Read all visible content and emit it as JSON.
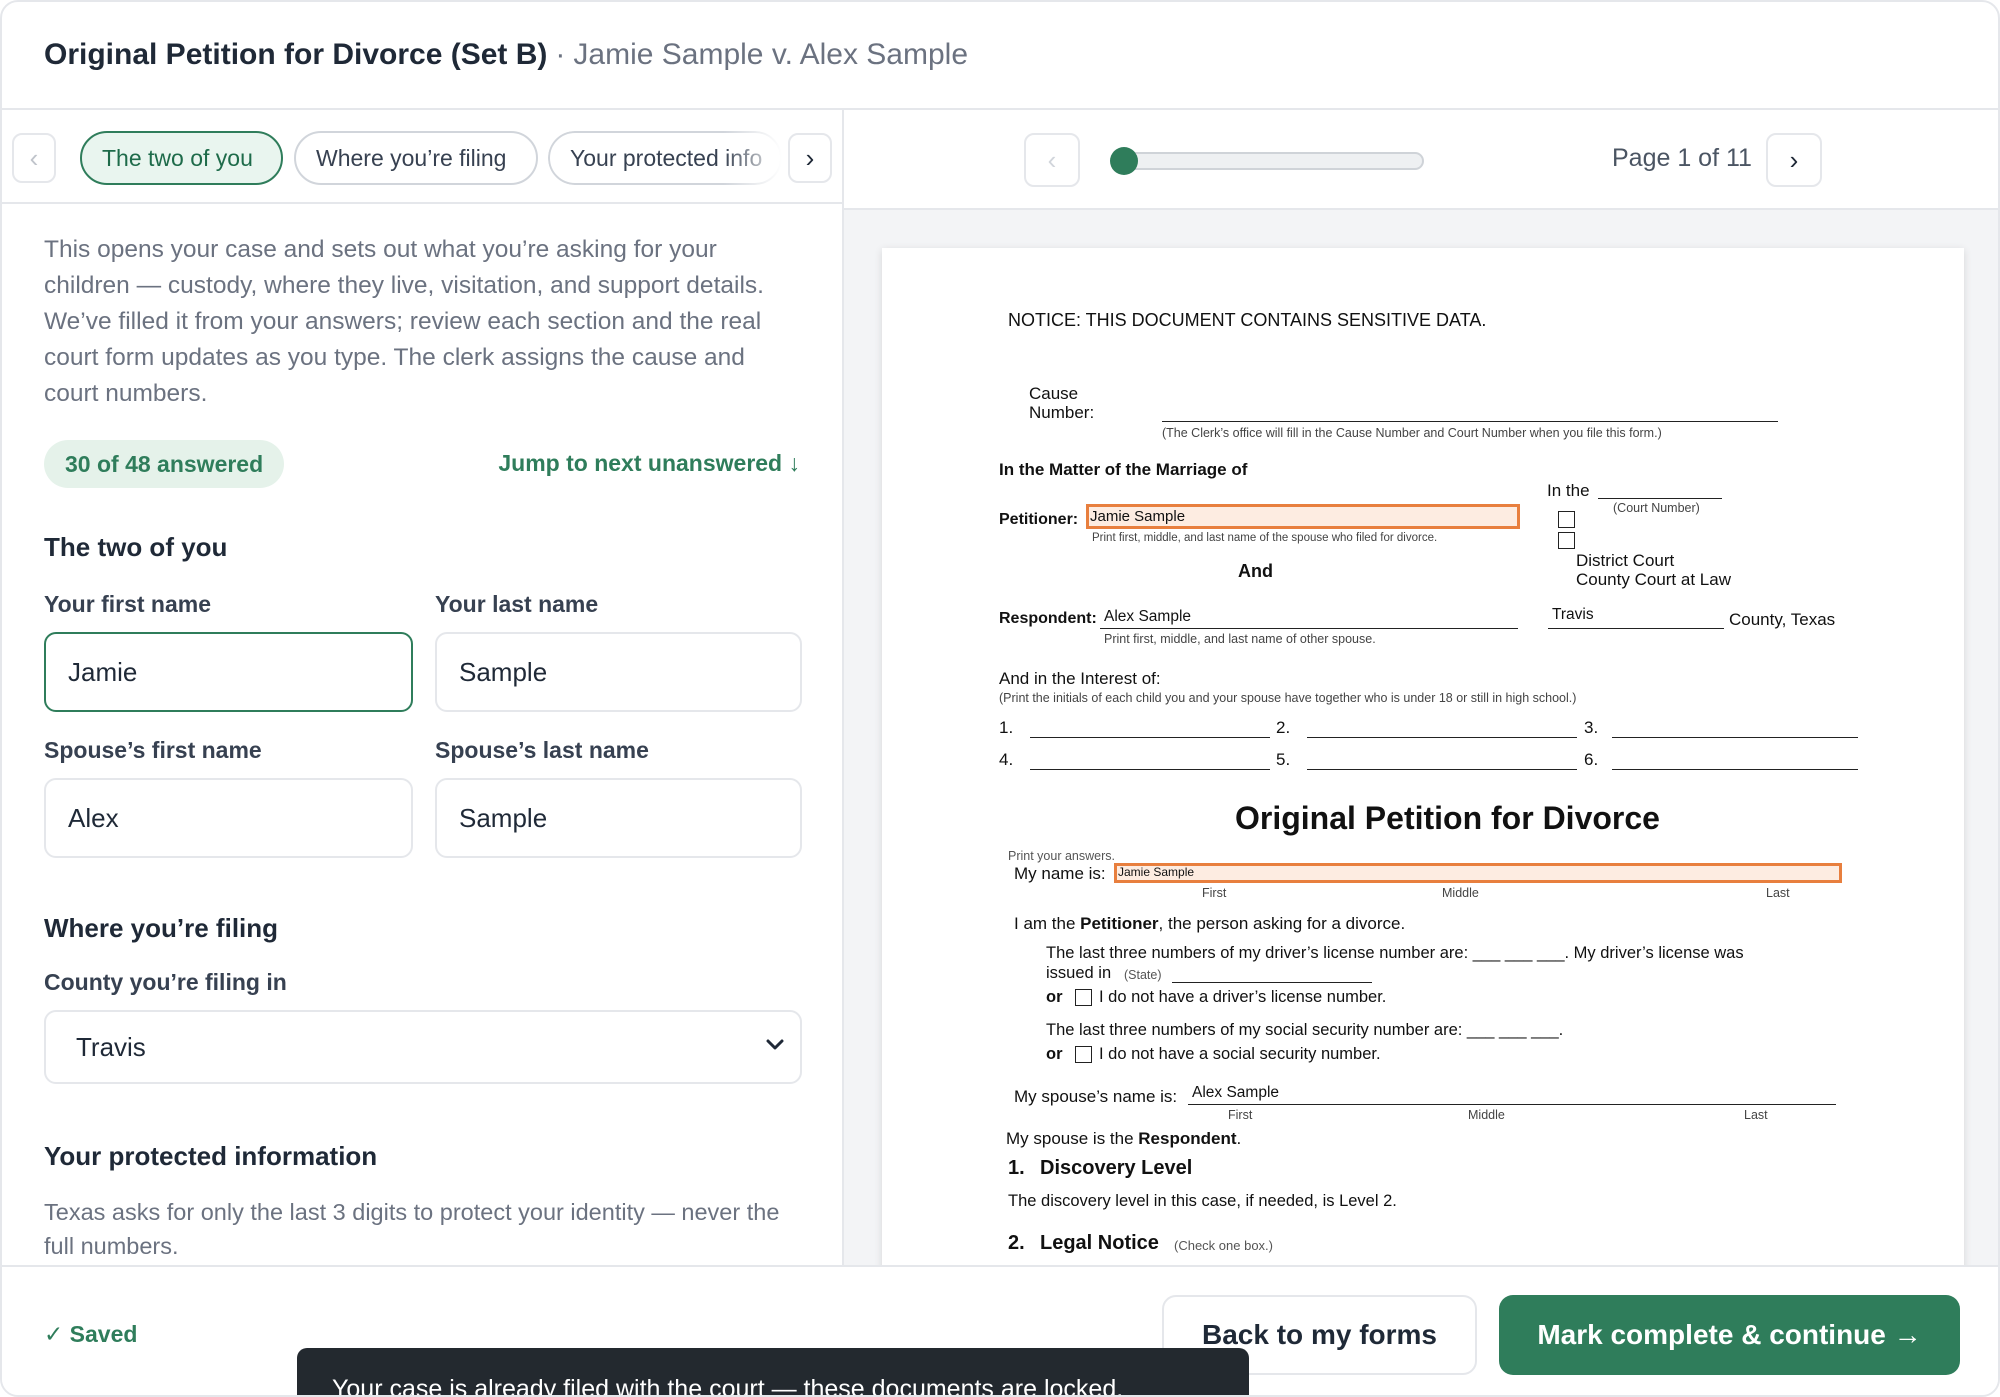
{
  "header": {
    "title": "Original Petition for Divorce (Set B)",
    "separator": "·",
    "case_name": "Jamie Sample v. Alex Sample"
  },
  "tabs": [
    {
      "label": "The two of you",
      "active": true
    },
    {
      "label": "Where you’re filing",
      "active": false
    },
    {
      "label": "Your protected info",
      "active": false
    }
  ],
  "icons": {
    "prev": "‹",
    "next": "›",
    "chevron_down": "⌄"
  },
  "intro": "This opens your case and sets out what you’re asking for your children — custody, where they live, visitation, and support details. We’ve filled it from your answers; review each section and the real court form updates as you type. The clerk assigns the cause and court numbers.",
  "progress": {
    "answered_label": "30 of 48 answered",
    "answered": 30,
    "total": 48,
    "jump_label": "Jump to next unanswered ↓"
  },
  "sections": {
    "two_of_you": {
      "title": "The two of you",
      "first_name_label": "Your first name",
      "first_name": "Jamie",
      "last_name_label": "Your last name",
      "last_name": "Sample",
      "spouse_first_label": "Spouse’s first name",
      "spouse_first": "Alex",
      "spouse_last_label": "Spouse’s last name",
      "spouse_last": "Sample"
    },
    "filing": {
      "title": "Where you’re filing",
      "county_label": "County you’re filing in",
      "county": "Travis"
    },
    "protected": {
      "title": "Your protected information",
      "description": "Texas asks for only the last 3 digits to protect your identity — never the full numbers."
    }
  },
  "pager": {
    "label": "Page 1 of 11",
    "page": 1,
    "total": 11
  },
  "document": {
    "notice": "NOTICE: THIS DOCUMENT CONTAINS SENSITIVE DATA.",
    "cause_label_1": "Cause",
    "cause_label_2": "Number:",
    "cause_hint": "(The Clerk’s office will fill in the Cause Number and Court Number when you file this form.)",
    "matter": "In the Matter of the Marriage of",
    "in_the": "In the",
    "court_number": "(Court Number)",
    "petitioner_label": "Petitioner:",
    "petitioner_value": "Jamie Sample",
    "petitioner_hint": "Print first, middle, and last name of the spouse who filed for divorce.",
    "and": "And",
    "district_court": "District Court",
    "county_court": "County Court at Law",
    "respondent_label": "Respondent:",
    "respondent_value": "Alex Sample",
    "respondent_hint": "Print first, middle, and last name of other spouse.",
    "county_value": "Travis",
    "county_texas": "County, Texas",
    "interest": "And in the Interest of:",
    "interest_hint": "(Print the initials of each child you and your spouse have together who is under 18 or still in high school.)",
    "child_numbers": [
      "1.",
      "2.",
      "3.",
      "4.",
      "5.",
      "6."
    ],
    "form_title": "Original Petition for Divorce",
    "print_answers": "Print your answers.",
    "my_name_label": "My name is:",
    "my_name_value": "Jamie Sample",
    "first": "First",
    "middle": "Middle",
    "last": "Last",
    "petitioner_line_pre": "I am the ",
    "petitioner_word": "Petitioner",
    "petitioner_line_post": ", the person asking for a divorce.",
    "license_line": "The last three numbers of my driver’s license number are: ___ ___ ___. My driver’s license was",
    "issued_in": "issued in",
    "state_hint": "(State)",
    "or": "or",
    "no_license": "I do not have a driver’s license number.",
    "ssn_line": "The last three numbers of my social security number are: ___ ___ ___.",
    "no_ssn": "I do not have a social security number.",
    "spouse_name_label": "My spouse’s name is:",
    "spouse_name_value": "Alex Sample",
    "spouse_is": "My spouse is the ",
    "respondent_word": "Respondent",
    "period": ".",
    "discovery_num": "1.",
    "discovery_title": "Discovery Level",
    "discovery_text": "The discovery level in this case, if needed, is Level 2.",
    "legal_num": "2.",
    "legal_title": "Legal Notice",
    "legal_hint": "(Check one box.)"
  },
  "footer": {
    "saved_label": "✓ Saved",
    "back_label": "Back to my forms",
    "primary_label": "Mark complete & continue →"
  },
  "toast": {
    "message": "Your case is already filed with the court — these documents are locked."
  },
  "colors": {
    "accent": "#2f7d5b",
    "highlight": "#e87f3e",
    "toast_bg": "#23292f"
  }
}
